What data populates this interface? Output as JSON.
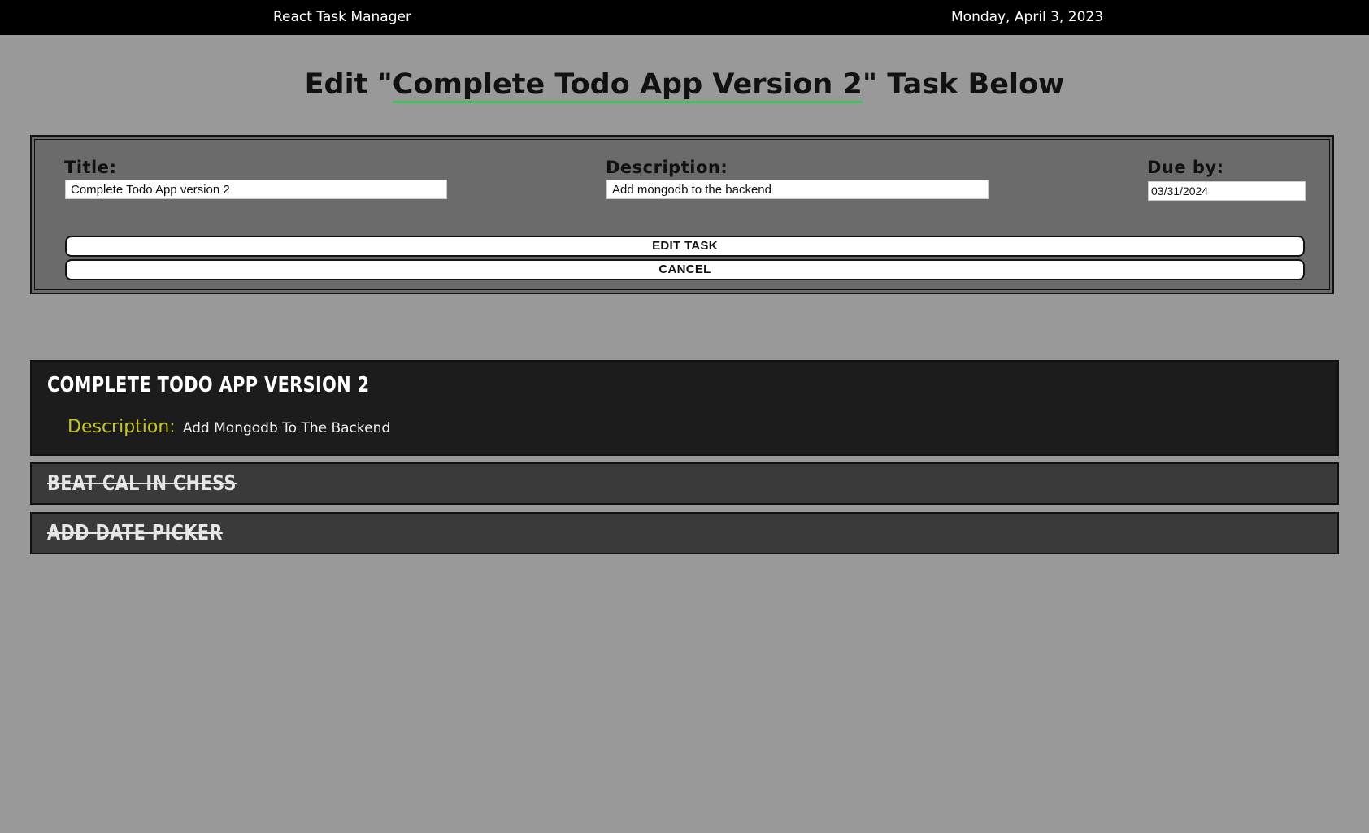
{
  "header": {
    "app_title": "React Task Manager",
    "date": "Monday, April 3, 2023"
  },
  "page": {
    "heading_prefix": "Edit \"",
    "heading_task": "Complete Todo App Version 2",
    "heading_suffix": "\" Task Below"
  },
  "edit_form": {
    "title_label": "Title:",
    "title_value": "Complete Todo App version 2",
    "description_label": "Description:",
    "description_value": "Add mongodb to the backend",
    "due_label": "Due by:",
    "due_value": "03/31/2024",
    "edit_button_label": "EDIT TASK",
    "cancel_button_label": "CANCEL"
  },
  "tasks": [
    {
      "title": "Complete Todo App Version 2",
      "description_label": "Description:",
      "description": "Add Mongodb To The Backend",
      "completed": false
    },
    {
      "title": "Beat Cal In Chess",
      "completed": true
    },
    {
      "title": "Add Date Picker",
      "completed": true
    }
  ],
  "colors": {
    "background": "#999999",
    "topbar": "#000000",
    "form_background": "#6b6b6b",
    "active_task_background": "#1c1c1c",
    "completed_task_background": "#3a3a3a",
    "description_label": "#c6c629",
    "heading_underline": "#3fbf5c"
  }
}
